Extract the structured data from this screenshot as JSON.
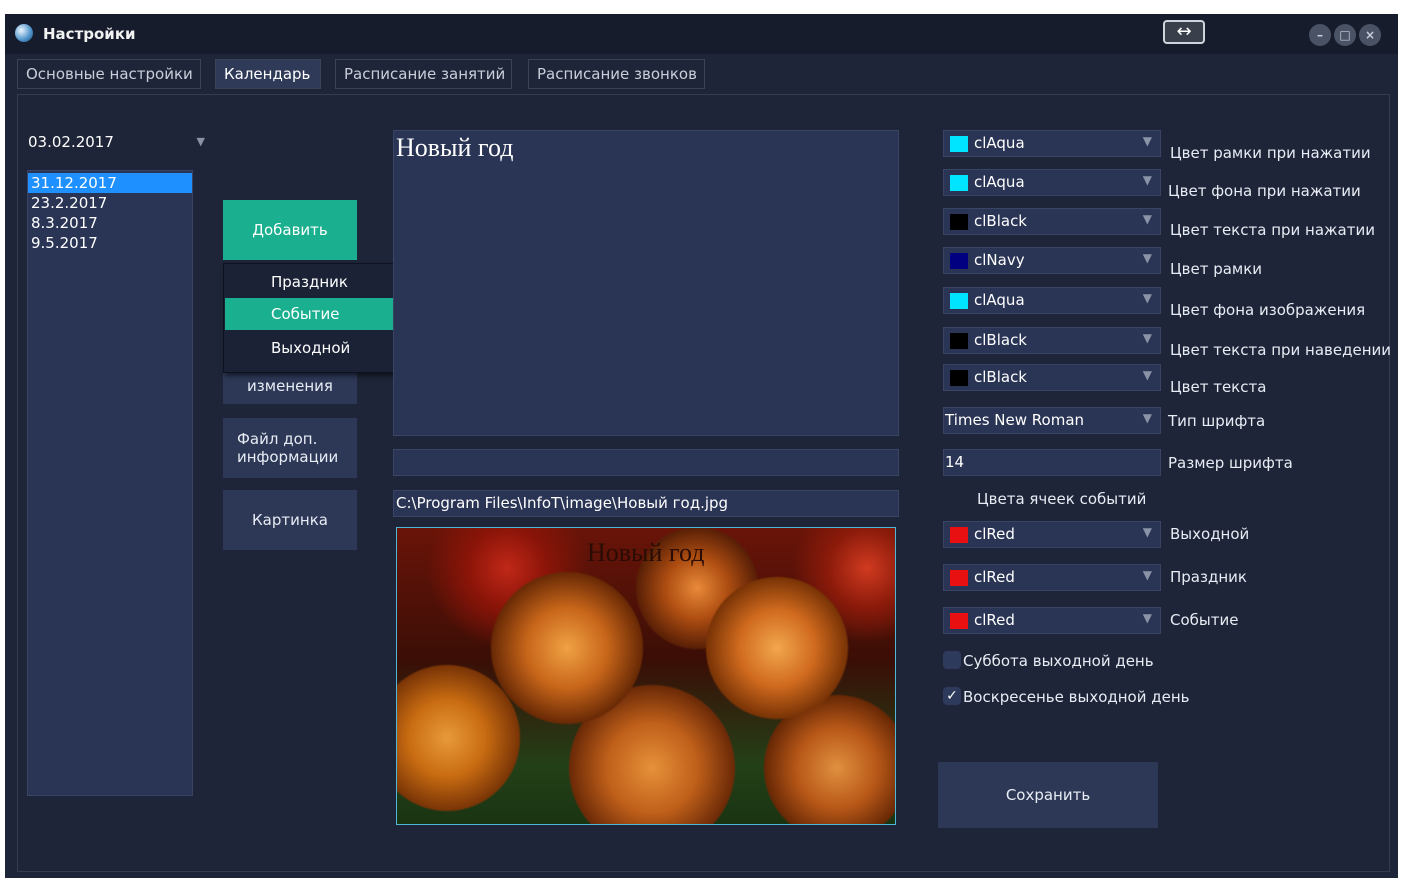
{
  "window": {
    "title": "Настройки",
    "swap_icon": "↔",
    "controls": [
      "minimize-icon",
      "maximize-icon",
      "close-icon"
    ]
  },
  "tabs": [
    {
      "label": "Основные настройки",
      "active": false
    },
    {
      "label": "Календарь",
      "active": true
    },
    {
      "label": "Расписание занятий",
      "active": false
    },
    {
      "label": "Расписание звонков",
      "active": false
    }
  ],
  "date_select": {
    "value": "03.02.2017"
  },
  "date_list": [
    "31.12.2017",
    "23.2.2017",
    "8.3.2017",
    "9.5.2017"
  ],
  "buttons": {
    "add": "Добавить",
    "apply_partial": "изменения",
    "info_file": "Файл доп. информации",
    "picture": "Картинка",
    "save": "Сохранить"
  },
  "menu": [
    "Праздник",
    "Событие",
    "Выходной"
  ],
  "event_text": "Новый год",
  "extra_field": "",
  "image_path": "C:\\Program Files\\InfoT\\image\\Новый год.jpg",
  "image_caption": "Новый год",
  "color_settings": [
    {
      "value": "clAqua",
      "color": "#00e5ff",
      "label": "Цвет рамки при нажатии"
    },
    {
      "value": "clAqua",
      "color": "#00e5ff",
      "label": "Цвет фона при нажатии"
    },
    {
      "value": "clBlack",
      "color": "#000000",
      "label": "Цвет текста при нажатии"
    },
    {
      "value": "clNavy",
      "color": "#000080",
      "label": "Цвет рамки"
    },
    {
      "value": "clAqua",
      "color": "#00e5ff",
      "label": "Цвет фона изображения"
    },
    {
      "value": "clBlack",
      "color": "#000000",
      "label": "Цвет текста при наведении"
    },
    {
      "value": "clBlack",
      "color": "#000000",
      "label": "Цвет текста"
    }
  ],
  "font_type": {
    "value": "Times New Roman",
    "label": "Тип шрифта"
  },
  "font_size": {
    "value": "14",
    "label": "Размер шрифта"
  },
  "event_colors_heading": "Цвета ячеек событий",
  "event_colors": [
    {
      "value": "clRed",
      "color": "#e81010",
      "label": "Выходной"
    },
    {
      "value": "clRed",
      "color": "#e81010",
      "label": "Праздник"
    },
    {
      "value": "clRed",
      "color": "#e81010",
      "label": "Событие"
    }
  ],
  "checkboxes": [
    {
      "label": "Суббота выходной день",
      "checked": false
    },
    {
      "label": "Воскресенье выходной день",
      "checked": true
    }
  ]
}
